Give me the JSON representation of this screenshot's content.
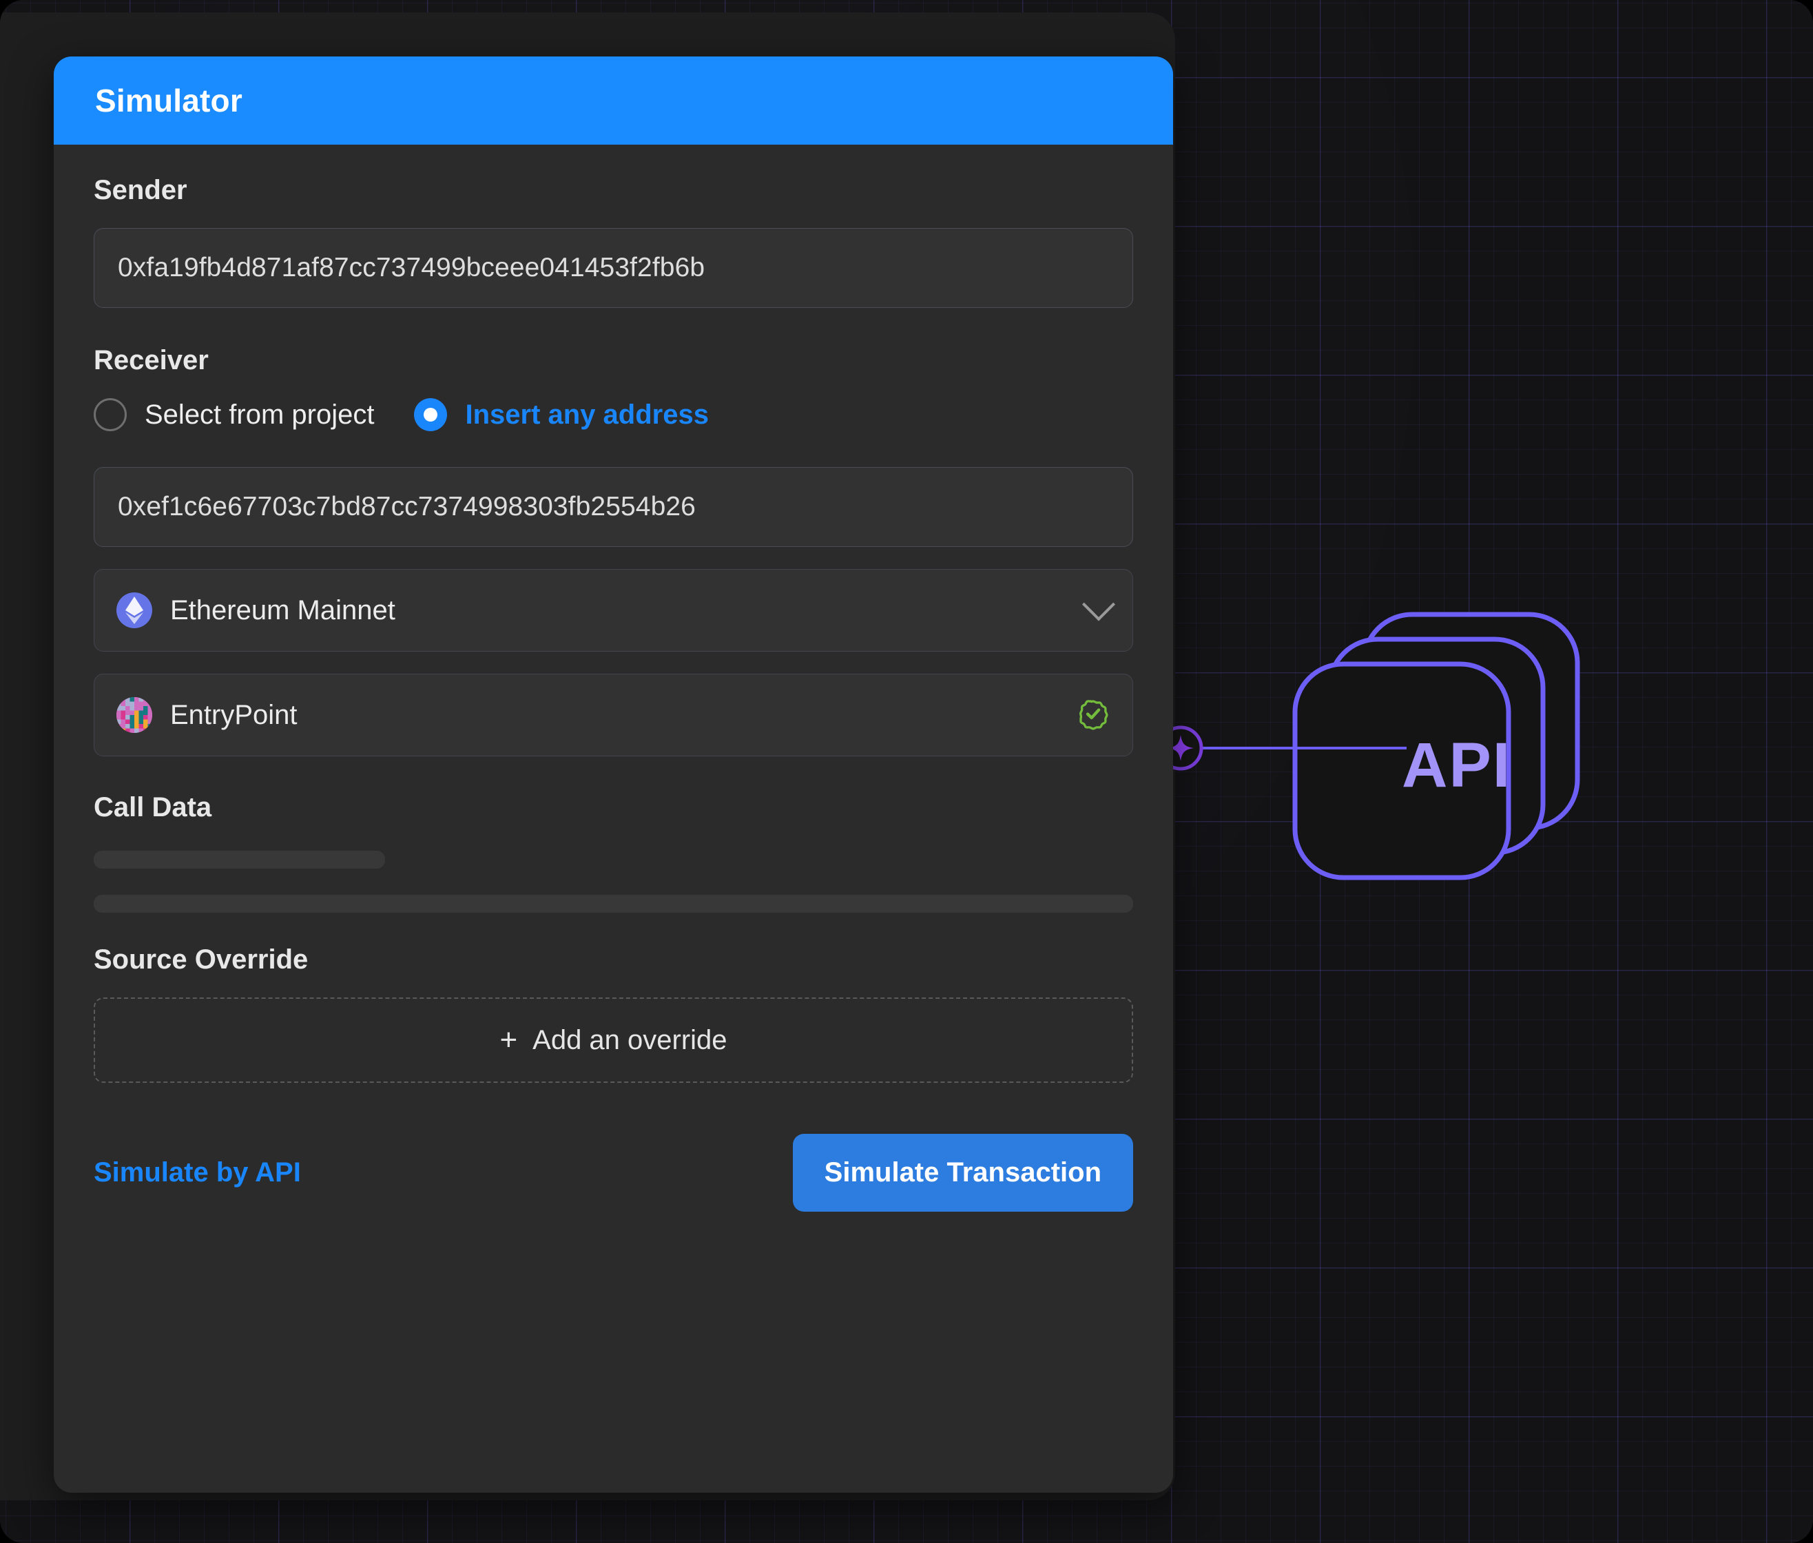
{
  "window": {
    "background_color": "#131316",
    "grid_color": "#6e5eeb"
  },
  "card": {
    "header": {
      "title": "Simulator",
      "color": "#1a8cff"
    },
    "sender": {
      "label": "Sender",
      "value": "0xfa19fb4d871af87cc737499bceee041453f2fb6b",
      "placeholder": "0x..."
    },
    "receiver": {
      "label": "Receiver",
      "options": [
        {
          "label": "Select from project",
          "selected": false
        },
        {
          "label": "Insert any address",
          "selected": true
        }
      ],
      "value": "0xef1c6e67703c7bd87cc7374998303fb2554b26",
      "placeholder": "0x..."
    },
    "network": {
      "name": "Ethereum Mainnet",
      "icon": "ethereum-icon",
      "chevron": "chevron-down-icon",
      "accent": "#6575e8"
    },
    "contract": {
      "name": "EntryPoint",
      "avatar": "blockie-avatar",
      "verified": true,
      "verified_icon": "verified-badge-icon",
      "verified_color": "#74bd3c"
    },
    "call_data": {
      "label": "Call Data",
      "loading": true
    },
    "source_override": {
      "label": "Source Override",
      "add_label": "Add an override",
      "add_icon": "plus-icon"
    },
    "footer": {
      "link_label": "Simulate by API",
      "link_color": "#1a86fb",
      "button_label": "Simulate Transaction",
      "button_color": "#2d7ce0"
    }
  },
  "api_graphic": {
    "label": "API",
    "stack_count": 3,
    "outline_color": "#6d5ef5",
    "text_color": "#a193f8",
    "connector_icon": "sparkle-node-icon"
  }
}
